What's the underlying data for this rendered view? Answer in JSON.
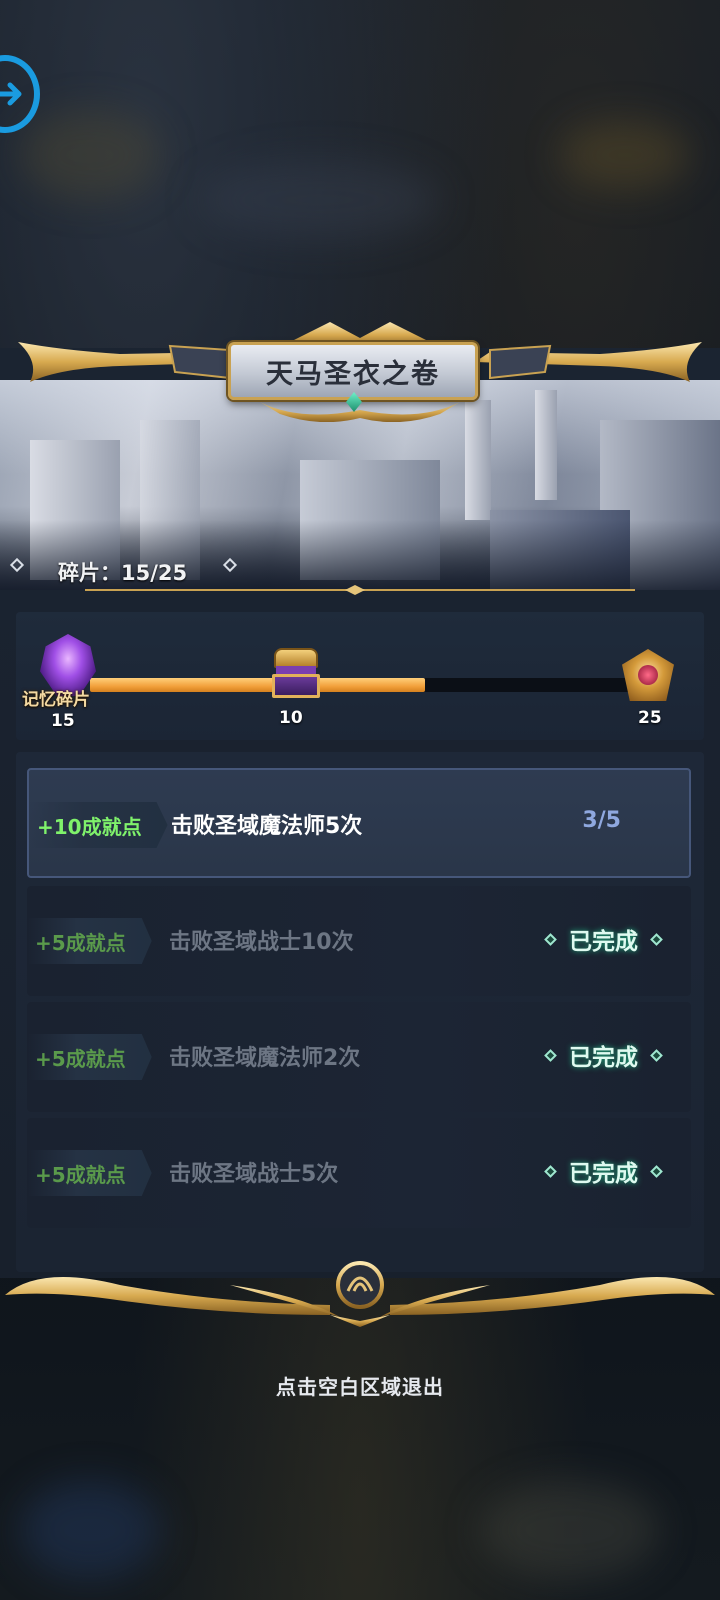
{
  "dialog": {
    "title": "天马圣衣之卷",
    "fragments_text": "碎片：15/25"
  },
  "progress": {
    "label": "记忆碎片",
    "current": 15,
    "max": 25,
    "fill_fraction": 0.62,
    "ticks": [
      "15",
      "10",
      "25"
    ]
  },
  "tasks": [
    {
      "reward": "+10成就点",
      "desc": "击败圣域魔法师5次",
      "progress": "3/5",
      "status": ""
    },
    {
      "reward": "+5成就点",
      "desc": "击败圣域战士10次",
      "progress": "",
      "status": "已完成"
    },
    {
      "reward": "+5成就点",
      "desc": "击败圣域魔法师2次",
      "progress": "",
      "status": "已完成"
    },
    {
      "reward": "+5成就点",
      "desc": "击败圣域战士5次",
      "progress": "",
      "status": "已完成"
    }
  ],
  "footer": {
    "exit_hint": "点击空白区域退出"
  },
  "icons": {
    "exit": "arrow-right-circle-icon",
    "crystal": "memory-crystal-icon",
    "chest": "treasure-chest-icon",
    "big_chest": "golden-chest-icon"
  },
  "colors": {
    "accent_blue": "#1a9be0",
    "progress_orange": "#f2a03b",
    "reward_green": "#7ff26b",
    "gold": "#c9a252"
  }
}
